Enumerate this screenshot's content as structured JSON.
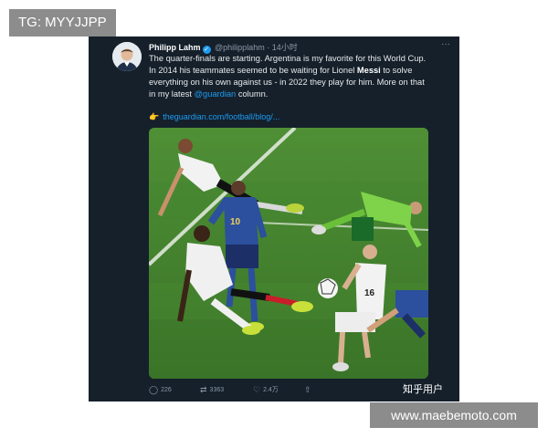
{
  "watermark_top": "TG: MYYJJPP",
  "watermark_bottom": "www.maebemoto.com",
  "source_label": "知乎用户",
  "tweet": {
    "name": "Philipp Lahm",
    "handle": "@philipplahm",
    "time": "14小时",
    "more_label": "···",
    "text_1": "The quarter-finals are starting. Argentina is my favorite for this World Cup. In 2014 his teammates seemed to be waiting for Lionel ",
    "text_bold": "Messi",
    "text_2": " to solve everything on his own against us - in 2022 they play for him. More on that in my latest ",
    "mention": "@guardian",
    "text_3": " column.",
    "url": "theguardian.com/football/blog/...",
    "replies": "226",
    "retweets": "3363",
    "likes": "2.4万"
  },
  "photo": {
    "numbers": [
      "10",
      "16"
    ]
  },
  "colors": {
    "tweet_bg": "#15202b",
    "accent": "#1d9bf0",
    "pitch": "#3f7d2c"
  },
  "icons": [
    "verified-badge-icon",
    "hand-pointing-icon",
    "reply-icon",
    "retweet-icon",
    "like-icon",
    "share-icon"
  ]
}
